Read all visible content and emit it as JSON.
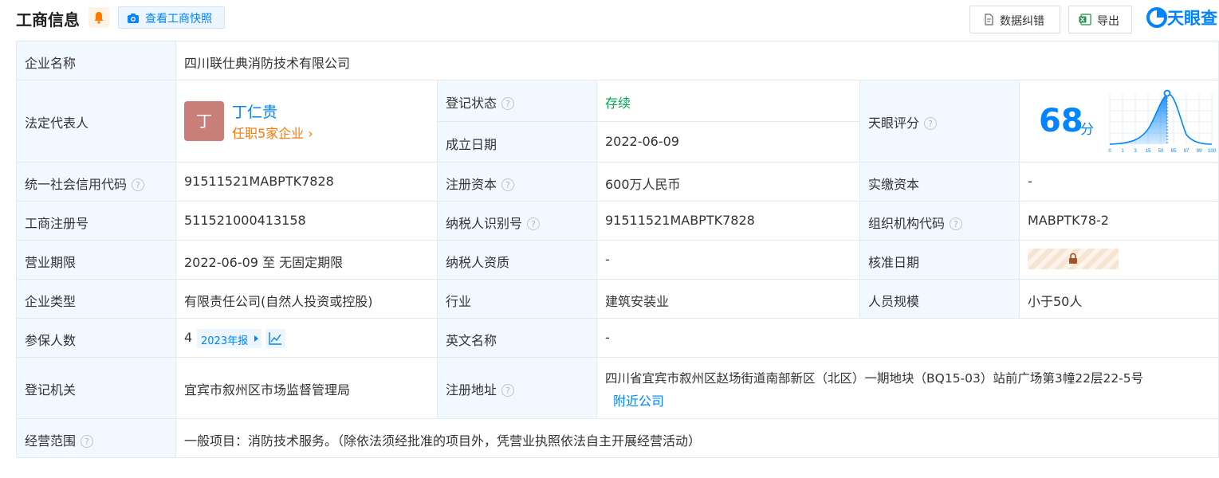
{
  "header": {
    "title": "工商信息",
    "snapshot_label": "查看工商快照",
    "error_label": "数据纠错",
    "export_label": "导出",
    "logo_text": "天眼查",
    "accent_color": "#0084ff",
    "label_bg_color": "#f2f8ff"
  },
  "company": {
    "name_label": "企业名称",
    "name": "四川联仕典消防技术有限公司",
    "legal_label": "法定代表人",
    "legal_avatar": "丁",
    "legal_name": "丁仁贵",
    "legal_jobs": "任职5家企业",
    "status_label": "登记状态",
    "status": "存续",
    "founded_label": "成立日期",
    "founded": "2022-06-09",
    "tianyan_label": "天眼评分",
    "tianyan_score": "68",
    "tianyan_unit": "分",
    "score_axis": [
      "0",
      "1",
      "3",
      "15",
      "50",
      "85",
      "97",
      "99",
      "100"
    ],
    "credit_label": "统一社会信用代码",
    "credit_code": "91511521MABPTK7828",
    "capital_label": "注册资本",
    "capital": "600万人民币",
    "paid_label": "实缴资本",
    "paid": "-",
    "regno_label": "工商注册号",
    "regno": "511521000413158",
    "taxid_label": "纳税人识别号",
    "taxid": "91511521MABPTK7828",
    "orgcode_label": "组织机构代码",
    "orgcode": "MABPTK78-2",
    "term_label": "营业期限",
    "term": "2022-06-09 至 无固定期限",
    "taxqual_label": "纳税人资质",
    "taxqual": "-",
    "approve_label": "核准日期",
    "type_label": "企业类型",
    "type": "有限责任公司(自然人投资或控股)",
    "industry_label": "行业",
    "industry": "建筑安装业",
    "staff_label": "人员规模",
    "staff": "小于50人",
    "insured_label": "参保人数",
    "insured": "4",
    "insured_report": "2023年报",
    "english_label": "英文名称",
    "english": "-",
    "authority_label": "登记机关",
    "authority": "宜宾市叙州区市场监督管理局",
    "address_label": "注册地址",
    "address": "四川省宜宾市叙州区赵场街道南部新区（北区）一期地块（BQ15-03）站前广场第3幢22层22-5号",
    "nearby": "附近公司",
    "scope_label": "经营范围",
    "scope": "一般项目：消防技术服务。（除依法须经批准的项目外，凭营业执照依法自主开展经营活动）"
  }
}
